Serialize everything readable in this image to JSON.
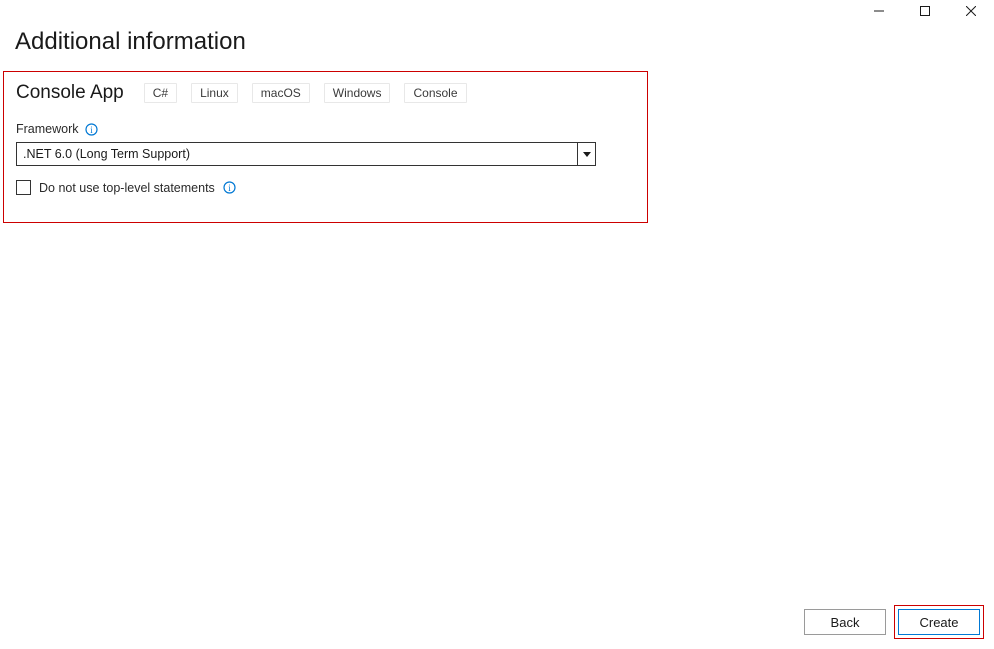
{
  "page": {
    "title": "Additional information"
  },
  "project": {
    "app_name": "Console App",
    "tags": [
      "C#",
      "Linux",
      "macOS",
      "Windows",
      "Console"
    ]
  },
  "framework": {
    "label": "Framework",
    "selected": ".NET 6.0 (Long Term Support)"
  },
  "checkbox": {
    "label": "Do not use top-level statements",
    "checked": false
  },
  "buttons": {
    "back": "Back",
    "create": "Create"
  }
}
